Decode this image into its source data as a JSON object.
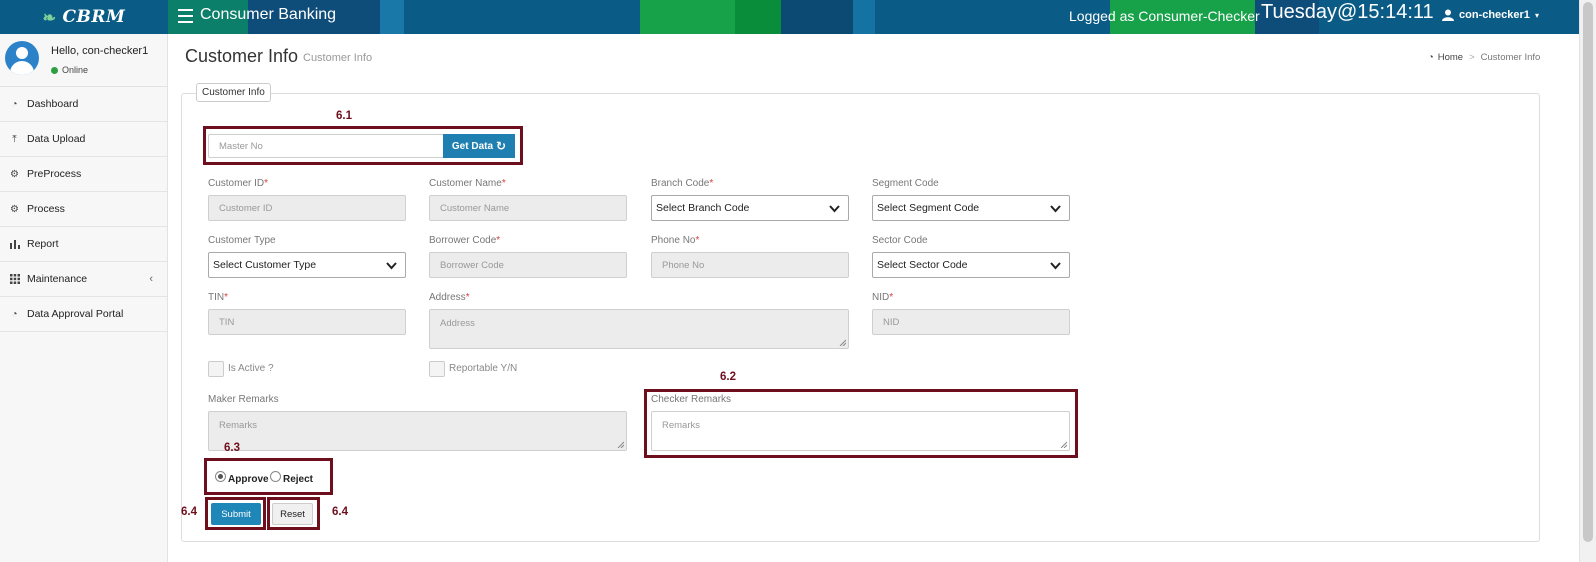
{
  "header": {
    "brand": "CBRM",
    "app_title": "Consumer Banking",
    "logged_as": "Logged as Consumer-Checker",
    "clock": "Tuesday@15:14:11",
    "user": "con-checker1"
  },
  "sidebar": {
    "greeting": "Hello, con-checker1",
    "status": "Online",
    "items": [
      {
        "label": "Dashboard",
        "icon": "dashboard-icon"
      },
      {
        "label": "Data Upload",
        "icon": "upload-icon"
      },
      {
        "label": "PreProcess",
        "icon": "cogs-icon"
      },
      {
        "label": "Process",
        "icon": "gear-icon"
      },
      {
        "label": "Report",
        "icon": "bar-chart-icon"
      },
      {
        "label": "Maintenance",
        "icon": "grid-icon"
      },
      {
        "label": "Data Approval Portal",
        "icon": "dashboard-icon"
      }
    ]
  },
  "page": {
    "title": "Customer Info",
    "subtitle": "Customer Info",
    "breadcrumb_home": "Home",
    "breadcrumb_separator": ">",
    "breadcrumb_current": "Customer Info"
  },
  "form": {
    "legend": "Customer Info",
    "master_no_placeholder": "Master No",
    "get_data_label": "Get Data",
    "customer_id_label": "Customer ID",
    "customer_id_placeholder": "Customer ID",
    "customer_name_label": "Customer Name",
    "customer_name_placeholder": "Customer Name",
    "branch_code_label": "Branch Code",
    "branch_code_value": "Select Branch Code",
    "segment_code_label": "Segment Code",
    "segment_code_value": "Select Segment Code",
    "customer_type_label": "Customer Type",
    "customer_type_value": "Select Customer Type",
    "borrower_code_label": "Borrower Code",
    "borrower_code_placeholder": "Borrower Code",
    "phone_no_label": "Phone No",
    "phone_no_placeholder": "Phone No",
    "sector_code_label": "Sector Code",
    "sector_code_value": "Select Sector Code",
    "tin_label": "TIN",
    "tin_placeholder": "TIN",
    "address_label": "Address",
    "address_placeholder": "Address",
    "nid_label": "NID",
    "nid_placeholder": "NID",
    "is_active_label": "Is Active ?",
    "reportable_label": "Reportable Y/N",
    "maker_remarks_label": "Maker Remarks",
    "maker_remarks_placeholder": "Remarks",
    "checker_remarks_label": "Checker Remarks",
    "checker_remarks_placeholder": "Remarks",
    "approve_label": "Approve",
    "reject_label": "Reject",
    "decision": "Approve",
    "submit_label": "Submit",
    "reset_label": "Reset",
    "required_mark": "*"
  },
  "annotations": {
    "a61": "6.1",
    "a62": "6.2",
    "a63": "6.3",
    "a64_left": "6.4",
    "a64_right": "6.4"
  },
  "colors": {
    "topbar": "#0a5c86",
    "annotation": "#6d0f1c",
    "primary_button": "#1f86b8",
    "online": "#2e9e43",
    "required": "#d43f3a"
  }
}
